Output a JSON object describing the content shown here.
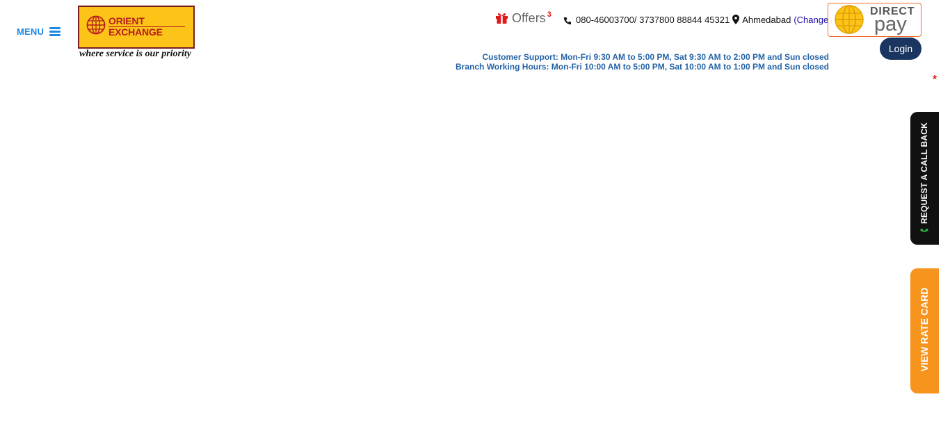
{
  "header": {
    "menu_label": "MENU",
    "logo": {
      "line1": "ORIENT",
      "line2": "EXCHANGE",
      "tagline": "where service is our priority"
    },
    "offers": {
      "label": "Offers",
      "count": "3",
      "icon": "gift-icon"
    },
    "contact": {
      "phone": "080-46003700/ 3737800 88844 45321",
      "city": "Ahmedabad",
      "change_label": "(Change)",
      "phone_icon": "phone-icon",
      "location_icon": "map-marker-icon"
    },
    "direct_pay": {
      "line1": "DIRECT",
      "line2": "pay"
    },
    "login_label": "Login",
    "customer_support": "Customer Support: Mon-Fri 9:30 AM to 5:00 PM, Sat 9:30 AM to 2:00 PM and Sun closed",
    "branch_hours": "Branch Working Hours: Mon-Fri 10:00 AM to 5:00 PM, Sat 10:00 AM to 1:00 PM and Sun closed",
    "asterisk": "*"
  },
  "side_tabs": {
    "callback_label": "REQUEST A CALL BACK",
    "ratecard_label": "VIEW RATE CARD"
  },
  "colors": {
    "accent_blue": "#1e88e5",
    "logo_yellow": "#fcc419",
    "logo_red": "#b71c1c",
    "login_navy": "#1a3560",
    "info_blue": "#2563a6",
    "rate_card_orange": "#f7941d",
    "directpay_border": "#f26c2b"
  }
}
